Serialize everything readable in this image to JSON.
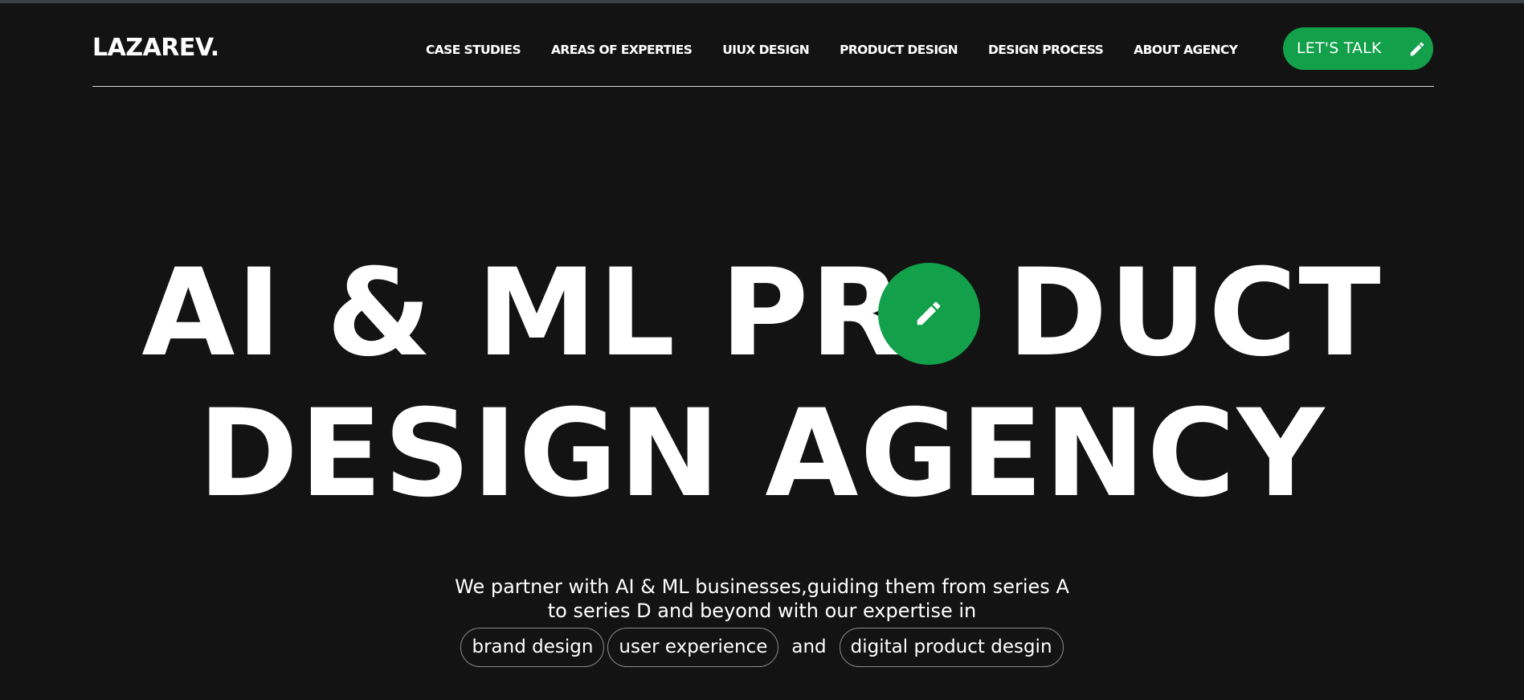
{
  "brand": {
    "logo_text": "LAZAREV."
  },
  "nav": {
    "items": [
      {
        "label": "CASE STUDIES"
      },
      {
        "label": "AREAS OF EXPERTIES"
      },
      {
        "label": "UIUX DESIGN"
      },
      {
        "label": "PRODUCT DESIGN"
      },
      {
        "label": "DESIGN PROCESS"
      },
      {
        "label": "ABOUT AGENCY"
      }
    ]
  },
  "cta": {
    "label": "LET'S TALK",
    "icon": "pencil-icon"
  },
  "hero": {
    "line1_left": "AI & ML PR",
    "line1_right": "DUCT",
    "line2": "DESIGN AGENCY",
    "circle_icon": "pencil-icon",
    "subtitle_line1": "We partner with AI & ML businesses,guiding them from series A",
    "subtitle_line2": "to series D and beyond with our expertise in",
    "tags": [
      "brand design",
      "user experience",
      "digital product desgin"
    ],
    "connector": "and"
  },
  "colors": {
    "background": "#131313",
    "accent": "#12a04a",
    "text": "#ffffff"
  }
}
